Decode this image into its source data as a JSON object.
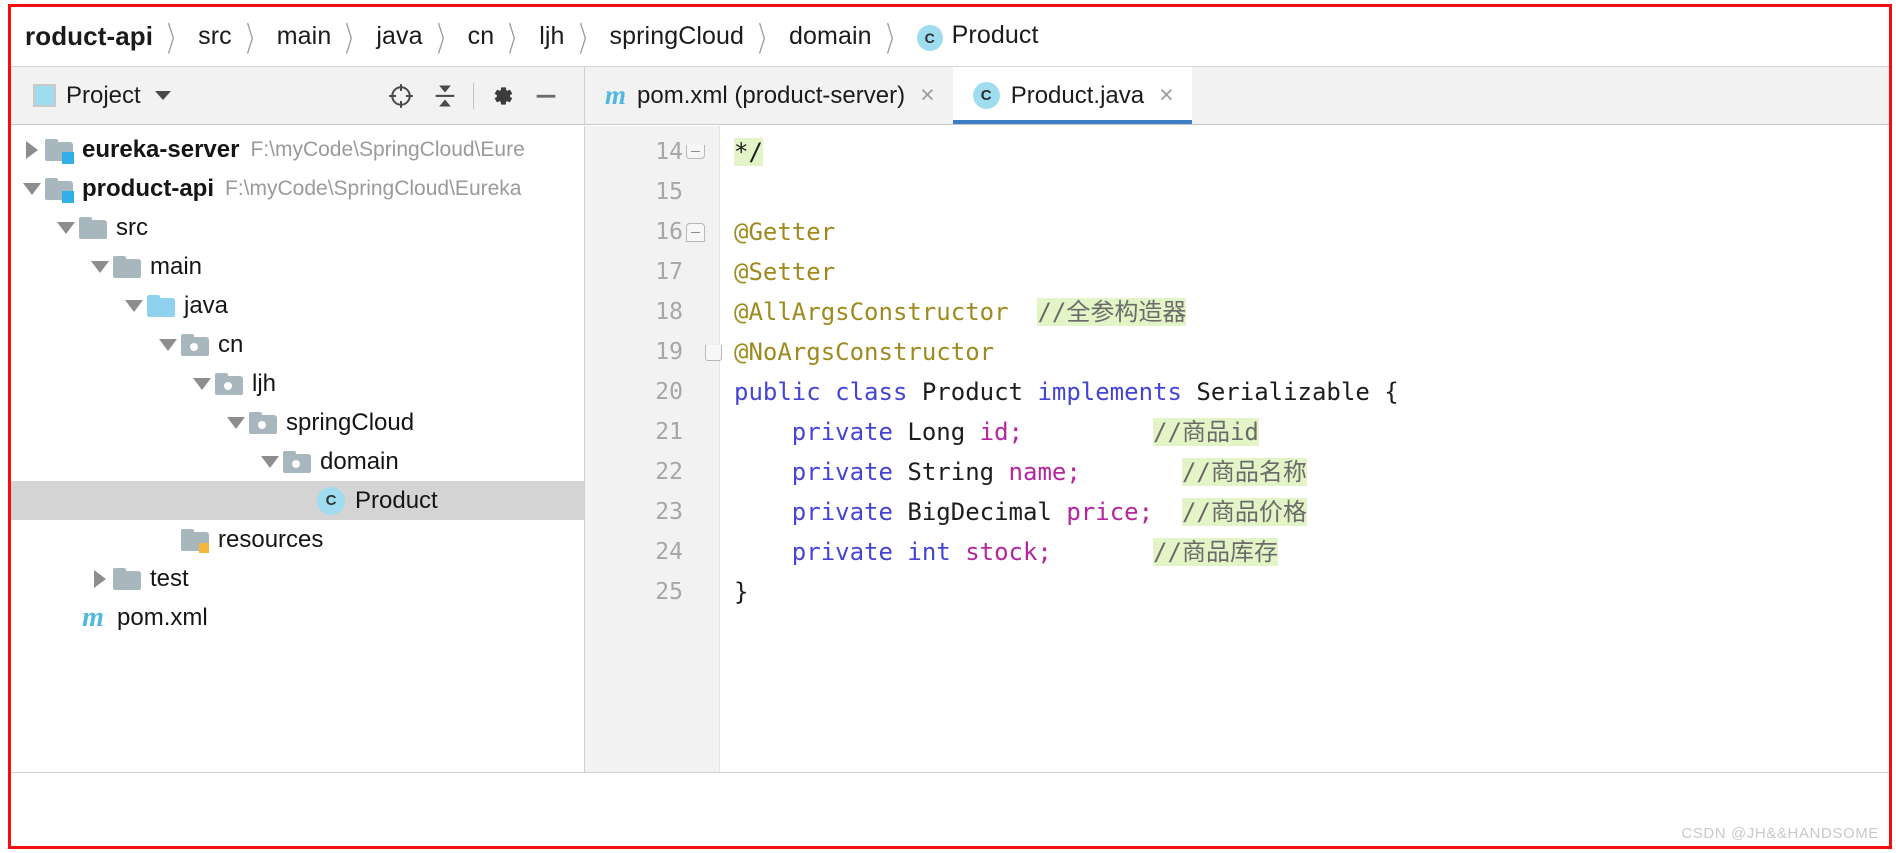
{
  "breadcrumb": {
    "items": [
      {
        "label": "roduct-api",
        "icon": "",
        "bold": true
      },
      {
        "label": "src",
        "icon": ""
      },
      {
        "label": "main",
        "icon": ""
      },
      {
        "label": "java",
        "icon": ""
      },
      {
        "label": "cn",
        "icon": ""
      },
      {
        "label": "ljh",
        "icon": ""
      },
      {
        "label": "springCloud",
        "icon": ""
      },
      {
        "label": "domain",
        "icon": ""
      },
      {
        "label": "Product",
        "icon": "class-icon",
        "icon_letter": "C"
      }
    ],
    "separator": "〉"
  },
  "project_panel": {
    "title": "Project",
    "dropdown_icon": "chevron-down-icon",
    "tools": [
      {
        "name": "locate-icon",
        "glyph": "⊕"
      },
      {
        "name": "collapse-all-icon",
        "glyph": "⤓"
      },
      {
        "name": "settings-gear-icon",
        "glyph": "⚙"
      },
      {
        "name": "hide-panel-icon",
        "glyph": "−"
      }
    ]
  },
  "tabs": [
    {
      "label": "pom.xml (product-server)",
      "icon": "maven-icon",
      "icon_letter": "m",
      "active": false,
      "close": "×"
    },
    {
      "label": "Product.java",
      "icon": "class-icon",
      "icon_letter": "C",
      "active": true,
      "close": "×"
    }
  ],
  "tree": [
    {
      "label": "eureka-server",
      "path": "F:\\myCode\\SpringCloud\\Eure",
      "indent": 0,
      "arrow": "right",
      "icon": "module-folder",
      "bold": true,
      "selected": false
    },
    {
      "label": "product-api",
      "path": "F:\\myCode\\SpringCloud\\Eureka",
      "indent": 0,
      "arrow": "down",
      "icon": "module-folder",
      "bold": true,
      "selected": false
    },
    {
      "label": "src",
      "path": "",
      "indent": 1,
      "arrow": "down",
      "icon": "folder",
      "bold": false,
      "selected": false
    },
    {
      "label": "main",
      "path": "",
      "indent": 2,
      "arrow": "down",
      "icon": "folder",
      "bold": false,
      "selected": false
    },
    {
      "label": "java",
      "path": "",
      "indent": 3,
      "arrow": "down",
      "icon": "source-folder",
      "bold": false,
      "selected": false
    },
    {
      "label": "cn",
      "path": "",
      "indent": 4,
      "arrow": "down",
      "icon": "package-folder",
      "bold": false,
      "selected": false
    },
    {
      "label": "ljh",
      "path": "",
      "indent": 5,
      "arrow": "down",
      "icon": "package-folder",
      "bold": false,
      "selected": false
    },
    {
      "label": "springCloud",
      "path": "",
      "indent": 6,
      "arrow": "down",
      "icon": "package-folder",
      "bold": false,
      "selected": false
    },
    {
      "label": "domain",
      "path": "",
      "indent": 7,
      "arrow": "down",
      "icon": "package-folder",
      "bold": false,
      "selected": false
    },
    {
      "label": "Product",
      "path": "",
      "indent": 8,
      "arrow": "none",
      "icon": "class-icon",
      "icon_letter": "C",
      "bold": false,
      "selected": true
    },
    {
      "label": "resources",
      "path": "",
      "indent": 4,
      "arrow": "none",
      "icon": "resources-folder",
      "bold": false,
      "selected": false
    },
    {
      "label": "test",
      "path": "",
      "indent": 2,
      "arrow": "right",
      "icon": "folder",
      "bold": false,
      "selected": false
    },
    {
      "label": "pom.xml",
      "path": "",
      "indent": 1,
      "arrow": "none",
      "icon": "maven-icon",
      "icon_letter": "m",
      "bold": false,
      "selected": false
    }
  ],
  "editor": {
    "file": "Product.java",
    "first_line": 14,
    "lines": [
      {
        "no": "14",
        "fold": "end",
        "tokens": [
          {
            "t": "*/",
            "c": "plain",
            "hl": "green"
          }
        ]
      },
      {
        "no": "15",
        "fold": "",
        "tokens": []
      },
      {
        "no": "16",
        "fold": "start",
        "tokens": [
          {
            "t": "@Getter",
            "c": "anno"
          }
        ]
      },
      {
        "no": "17",
        "fold": "",
        "tokens": [
          {
            "t": "@Setter",
            "c": "anno"
          }
        ]
      },
      {
        "no": "18",
        "fold": "",
        "tokens": [
          {
            "t": "@AllArgsConstructor  ",
            "c": "anno"
          },
          {
            "t": "//全参构造器",
            "c": "cmt",
            "hl": "green"
          }
        ]
      },
      {
        "no": "19",
        "fold": "tail",
        "tokens": [
          {
            "t": "@NoArgsConstructor",
            "c": "anno"
          }
        ]
      },
      {
        "no": "20",
        "fold": "",
        "tokens": [
          {
            "t": "public class ",
            "c": "kw"
          },
          {
            "t": "Product ",
            "c": "type"
          },
          {
            "t": "implements ",
            "c": "kw"
          },
          {
            "t": "Serializable {",
            "c": "plain"
          }
        ]
      },
      {
        "no": "21",
        "fold": "",
        "tokens": [
          {
            "t": "    private ",
            "c": "kw"
          },
          {
            "t": "Long ",
            "c": "type"
          },
          {
            "t": "id;",
            "c": "field"
          },
          {
            "t": "         ",
            "c": "plain"
          },
          {
            "t": "//商品id",
            "c": "cmt",
            "hl": "green"
          }
        ]
      },
      {
        "no": "22",
        "fold": "",
        "tokens": [
          {
            "t": "    private ",
            "c": "kw"
          },
          {
            "t": "String ",
            "c": "type"
          },
          {
            "t": "name;",
            "c": "field"
          },
          {
            "t": "       ",
            "c": "plain"
          },
          {
            "t": "//商品名称",
            "c": "cmt",
            "hl": "green"
          }
        ]
      },
      {
        "no": "23",
        "fold": "",
        "tokens": [
          {
            "t": "    private ",
            "c": "kw"
          },
          {
            "t": "BigDecimal ",
            "c": "type"
          },
          {
            "t": "price;",
            "c": "field"
          },
          {
            "t": "  ",
            "c": "plain"
          },
          {
            "t": "//商品价格",
            "c": "cmt",
            "hl": "green"
          }
        ]
      },
      {
        "no": "24",
        "fold": "",
        "tokens": [
          {
            "t": "    private ",
            "c": "kw"
          },
          {
            "t": "int ",
            "c": "kw"
          },
          {
            "t": "stock;",
            "c": "field"
          },
          {
            "t": "       ",
            "c": "plain"
          },
          {
            "t": "//商品库存",
            "c": "cmt",
            "hl": "green"
          }
        ]
      },
      {
        "no": "25",
        "fold": "",
        "tokens": [
          {
            "t": "}",
            "c": "plain"
          }
        ]
      }
    ]
  },
  "watermark": "CSDN @JH&&HANDSOME",
  "colors": {
    "frame_red": "#f40d0d",
    "accent_blue": "#3e7cc4",
    "class_icon_bg": "#9fdcf0",
    "annotation": "#9e8a1e",
    "keyword": "#4545d4",
    "field": "#b5259e",
    "comment_highlight": "#e3f5c6",
    "selection": "#d4d4d4"
  }
}
